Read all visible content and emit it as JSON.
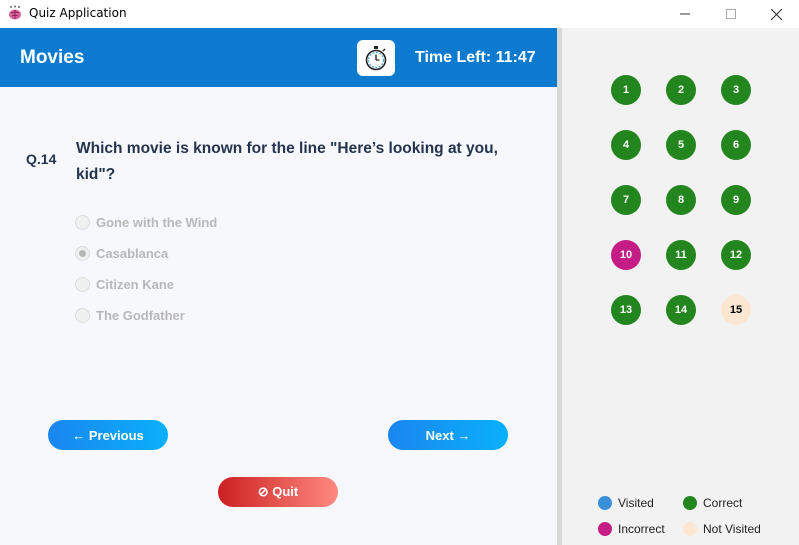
{
  "window": {
    "title": "Quiz Application",
    "controls": [
      "minimize",
      "maximize",
      "close"
    ]
  },
  "header": {
    "category": "Movies",
    "timer_icon": "stopwatch-icon",
    "time_left": "Time Left: 11:47"
  },
  "question": {
    "number": "Q.14",
    "text": "Which movie is known for the line \"Here’s looking at you, kid\"?",
    "options": [
      {
        "label": "Gone with the Wind",
        "selected": false
      },
      {
        "label": "Casablanca",
        "selected": true
      },
      {
        "label": "Citizen Kane",
        "selected": false
      },
      {
        "label": "The Godfather",
        "selected": false
      }
    ]
  },
  "buttons": {
    "previous": "← Previous",
    "next": "Next →",
    "quit": "⊘ Quit"
  },
  "navigator": {
    "questions": [
      {
        "label": "1",
        "status": "correct"
      },
      {
        "label": "2",
        "status": "correct"
      },
      {
        "label": "3",
        "status": "correct"
      },
      {
        "label": "4",
        "status": "correct"
      },
      {
        "label": "5",
        "status": "correct"
      },
      {
        "label": "6",
        "status": "correct"
      },
      {
        "label": "7",
        "status": "correct"
      },
      {
        "label": "8",
        "status": "correct"
      },
      {
        "label": "9",
        "status": "correct"
      },
      {
        "label": "10",
        "status": "incorrect"
      },
      {
        "label": "11",
        "status": "correct"
      },
      {
        "label": "12",
        "status": "correct"
      },
      {
        "label": "13",
        "status": "correct"
      },
      {
        "label": "14",
        "status": "correct"
      },
      {
        "label": "15",
        "status": "not-visited"
      }
    ]
  },
  "legend": [
    {
      "label": "Visited",
      "color": "#3a8fd9"
    },
    {
      "label": "Correct",
      "color": "#23851d"
    },
    {
      "label": "Incorrect",
      "color": "#c51d86"
    },
    {
      "label": "Not Visited",
      "color": "#fbe7d2"
    }
  ],
  "colors": {
    "header": "#0c7bcf",
    "correct": "#23851d",
    "incorrect": "#c51d86",
    "not_visited": "#fbe7d2",
    "visited": "#3a8fd9"
  }
}
